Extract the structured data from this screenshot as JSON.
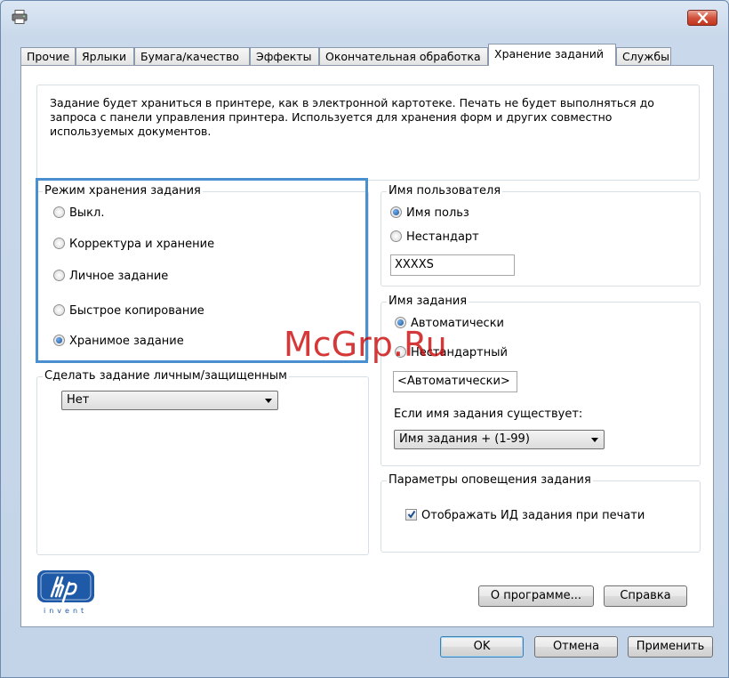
{
  "titlebar": {
    "close_icon": "close-icon",
    "app_icon": "printer-icon"
  },
  "tabs": [
    {
      "label": "Прочие",
      "active": false
    },
    {
      "label": "Ярлыки",
      "active": false
    },
    {
      "label": "Бумага/качество",
      "active": false
    },
    {
      "label": "Эффекты",
      "active": false
    },
    {
      "label": "Окончательная обработка",
      "active": false
    },
    {
      "label": "Хранение заданий",
      "active": true
    },
    {
      "label": "Службы",
      "active": false
    }
  ],
  "description": {
    "line1": "Задание будет храниться в принтере, как в электронной картотеке. Печать не будет выполняться до",
    "line2": "запроса с панели управления принтера. Используется для хранения форм и других совместно",
    "line3": "используемых документов."
  },
  "storage_mode": {
    "title": "Режим хранения задания",
    "options": [
      {
        "label": "Выкл.",
        "checked": false
      },
      {
        "label": "Корректура и хранение",
        "checked": false
      },
      {
        "label": "Личное задание",
        "checked": false
      },
      {
        "label": "Быстрое копирование",
        "checked": false
      },
      {
        "label": "Хранимое задание",
        "checked": true
      }
    ]
  },
  "private": {
    "title": "Сделать задание личным/защищенным",
    "selected": "Нет"
  },
  "username": {
    "title": "Имя пользователя",
    "option_user": "Имя польз",
    "option_custom": "Нестандарт",
    "value": "XXXXS"
  },
  "jobname": {
    "title": "Имя задания",
    "option_auto": "Автоматически",
    "option_custom": "Нестандартный",
    "value": "<Автоматически>",
    "exists_label": "Если имя задания существует:",
    "exists_selected": "Имя задания + (1-99)"
  },
  "notify": {
    "title": "Параметры оповещения задания",
    "show_id_label": "Отображать ИД задания при печати",
    "show_id_checked": true
  },
  "logo": {
    "text": "invent"
  },
  "buttons": {
    "about": "О программе...",
    "help": "Справка",
    "ok": "OK",
    "cancel": "Отмена",
    "apply": "Применить"
  },
  "watermark": "McGrp.Ru",
  "colors": {
    "highlight": "#4a8fd0",
    "hp_blue": "#1f5aa8",
    "watermark": "#c80000"
  }
}
